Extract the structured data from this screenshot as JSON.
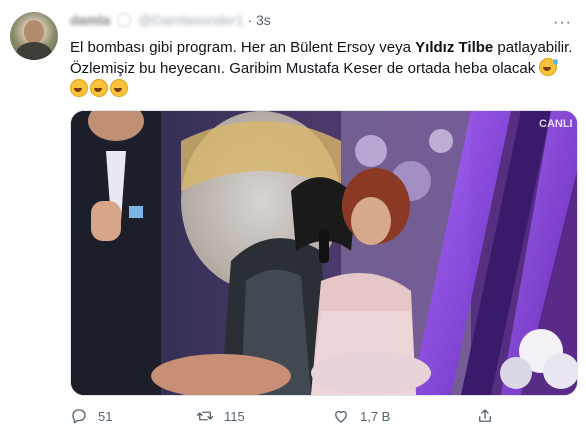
{
  "tweet": {
    "author_name": "damla",
    "author_handle": "@Damlasonder1",
    "separator": "·",
    "time": "3s",
    "more_label": "···",
    "text_line1_a": "El bombası gibi program. Her an Bülent  Ersoy veya ",
    "text_line1_bold": "Yıldız Tilbe",
    "text_line1_b": " patlayabilir.",
    "text_line2": "Özlemişiz bu heyecanı. Garibim Mustafa Keser de ortada heba olacak ",
    "media_watermark": "CANLI"
  },
  "actions": {
    "replies": "51",
    "retweets": "115",
    "likes": "1,7 B"
  },
  "colors": {
    "text": "#0f1419",
    "secondary": "#536471"
  }
}
